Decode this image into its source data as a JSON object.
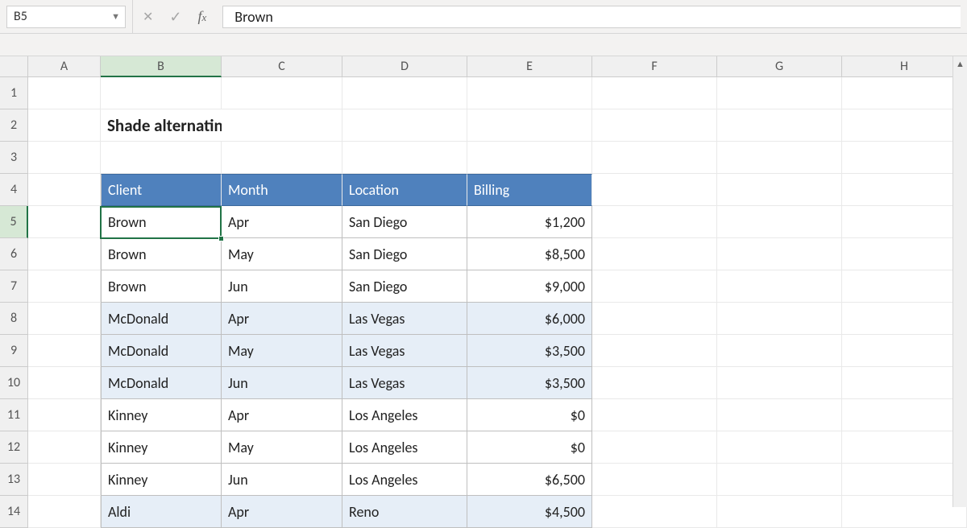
{
  "formula_bar": {
    "cell_ref": "B5",
    "value": "Brown"
  },
  "columns": [
    "A",
    "B",
    "C",
    "D",
    "E",
    "F",
    "G",
    "H"
  ],
  "row_numbers": [
    "1",
    "2",
    "3",
    "4",
    "5",
    "6",
    "7",
    "8",
    "9",
    "10",
    "11",
    "12",
    "13",
    "14"
  ],
  "title": "Shade alternating groups of n rows",
  "table": {
    "headers": [
      "Client",
      "Month",
      "Location",
      "Billing"
    ],
    "rows": [
      {
        "client": "Brown",
        "month": "Apr",
        "location": "San Diego",
        "billing": "$1,200",
        "shaded": false
      },
      {
        "client": "Brown",
        "month": "May",
        "location": "San Diego",
        "billing": "$8,500",
        "shaded": false
      },
      {
        "client": "Brown",
        "month": "Jun",
        "location": "San Diego",
        "billing": "$9,000",
        "shaded": false
      },
      {
        "client": "McDonald",
        "month": "Apr",
        "location": "Las Vegas",
        "billing": "$6,000",
        "shaded": true
      },
      {
        "client": "McDonald",
        "month": "May",
        "location": "Las Vegas",
        "billing": "$3,500",
        "shaded": true
      },
      {
        "client": "McDonald",
        "month": "Jun",
        "location": "Las Vegas",
        "billing": "$3,500",
        "shaded": true
      },
      {
        "client": "Kinney",
        "month": "Apr",
        "location": "Los Angeles",
        "billing": "$0",
        "shaded": false
      },
      {
        "client": "Kinney",
        "month": "May",
        "location": "Los Angeles",
        "billing": "$0",
        "shaded": false
      },
      {
        "client": "Kinney",
        "month": "Jun",
        "location": "Los Angeles",
        "billing": "$6,500",
        "shaded": false
      },
      {
        "client": "Aldi",
        "month": "Apr",
        "location": "Reno",
        "billing": "$4,500",
        "shaded": true
      }
    ]
  },
  "selected": {
    "col": "B",
    "row": "5"
  }
}
